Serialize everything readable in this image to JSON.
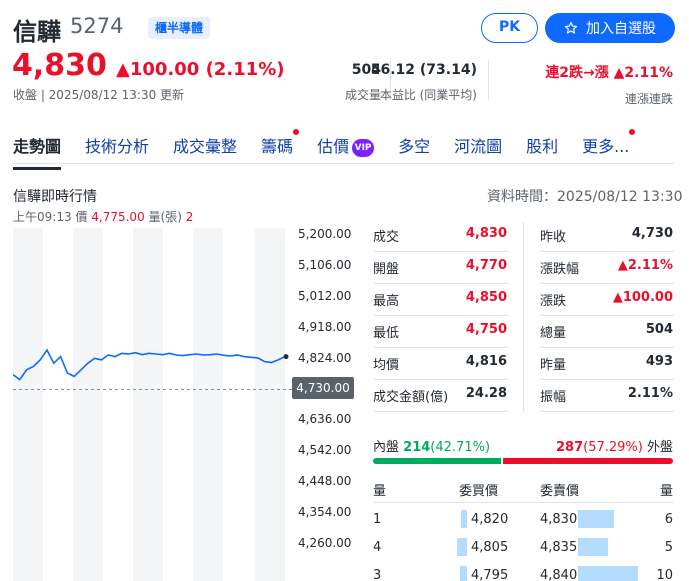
{
  "header": {
    "name": "信驊",
    "code": "5274",
    "badge": "櫃半導體",
    "pk_label": "PK",
    "watchlist_label": "加入自選股",
    "price": "4,830",
    "change": "▲100.00 (2.11%)",
    "close_info": "收盤 | 2025/08/12 13:30 更新"
  },
  "stats": [
    {
      "value": "504",
      "label": "成交量"
    },
    {
      "value": "56.12 (73.14)",
      "label": "本益比 (同業平均)"
    },
    {
      "value": "連2跌→漲 ▲2.11%",
      "label": "連漲連跌"
    }
  ],
  "tabs": [
    {
      "label": "走勢圖",
      "active": true,
      "dot": false
    },
    {
      "label": "技術分析",
      "dot": false
    },
    {
      "label": "成交彙整",
      "dot": false
    },
    {
      "label": "籌碼",
      "dot": true
    },
    {
      "label": "估價",
      "dot": false,
      "vip": "VIP"
    },
    {
      "label": "多空",
      "dot": false
    },
    {
      "label": "河流圖",
      "dot": false
    },
    {
      "label": "股利",
      "dot": false
    },
    {
      "label": "更多...",
      "dot": true
    }
  ],
  "chart_section": {
    "title": "信驊即時行情",
    "data_time": "資料時間：2025/08/12 13:30",
    "cursor_time": "上午09:13",
    "cursor_price_label": "價",
    "cursor_price": "4,775.00",
    "cursor_vol_label": "量(張)",
    "cursor_vol": "2"
  },
  "chart_data": {
    "type": "line",
    "y_ticks": [
      "5,200.00",
      "5,106.00",
      "5,012.00",
      "4,918.00",
      "4,824.00",
      "4,730.00",
      "4,636.00",
      "4,542.00",
      "4,448.00",
      "4,354.00",
      "4,260.00"
    ],
    "reference_price": "4,730.00",
    "ylim": [
      4260,
      5200
    ],
    "series": [
      {
        "values": [
          4775,
          4760,
          4790,
          4800,
          4820,
          4850,
          4810,
          4830,
          4780,
          4770,
          4790,
          4810,
          4825,
          4820,
          4835,
          4830,
          4840,
          4838,
          4842,
          4836,
          4840,
          4838,
          4836,
          4840,
          4835,
          4833,
          4836,
          4838,
          4835,
          4836,
          4838,
          4834,
          4832,
          4835,
          4830,
          4828,
          4826,
          4815,
          4812,
          4820,
          4830
        ]
      }
    ],
    "colors": {
      "line": "#0f69ff",
      "reference": "#8a8f95"
    }
  },
  "quote": {
    "left": [
      {
        "label": "成交",
        "value": "4,830",
        "up": true
      },
      {
        "label": "開盤",
        "value": "4,770",
        "up": true
      },
      {
        "label": "最高",
        "value": "4,850",
        "up": true
      },
      {
        "label": "最低",
        "value": "4,750",
        "up": true
      },
      {
        "label": "均價",
        "value": "4,816",
        "up": false
      },
      {
        "label": "成交金額(億)",
        "value": "24.28",
        "up": false
      }
    ],
    "right": [
      {
        "label": "昨收",
        "value": "4,730",
        "up": false
      },
      {
        "label": "漲跌幅",
        "value": "▲2.11%",
        "up": true
      },
      {
        "label": "漲跌",
        "value": "▲100.00",
        "up": true
      },
      {
        "label": "總量",
        "value": "504",
        "up": false
      },
      {
        "label": "昨量",
        "value": "493",
        "up": false
      },
      {
        "label": "振幅",
        "value": "2.11%",
        "up": false
      }
    ]
  },
  "bidask": {
    "in_label": "內盤",
    "in_value": "214",
    "in_pct": "(42.71%)",
    "out_value": "287",
    "out_pct": "(57.29%)",
    "out_label": "外盤",
    "in_ratio": 0.4271
  },
  "orderbook": {
    "headers": [
      "量",
      "委買價",
      "委賣價",
      "量"
    ],
    "rows": [
      {
        "bid_vol": "1",
        "bid_price": "4,820",
        "ask_price": "4,830",
        "ask_vol": "6",
        "bid_ratio": 0.1,
        "ask_ratio": 0.6
      },
      {
        "bid_vol": "4",
        "bid_price": "4,805",
        "ask_price": "4,835",
        "ask_vol": "5",
        "bid_ratio": 0.4,
        "ask_ratio": 0.5
      },
      {
        "bid_vol": "3",
        "bid_price": "4,795",
        "ask_price": "4,840",
        "ask_vol": "10",
        "bid_ratio": 0.3,
        "ask_ratio": 1.0
      }
    ]
  }
}
